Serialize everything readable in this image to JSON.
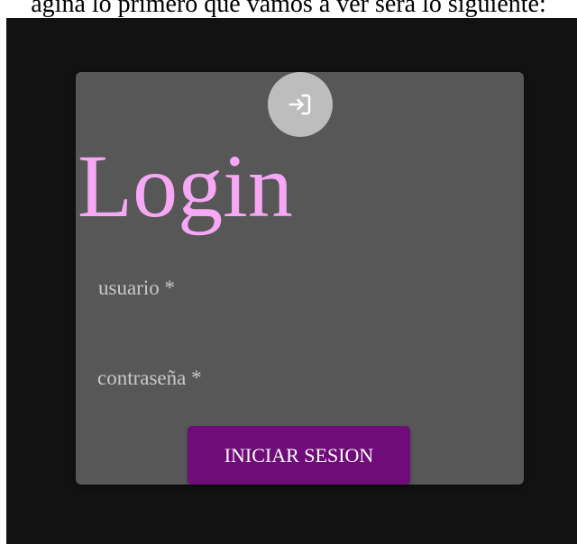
{
  "caption": "ágina lo primero que vamos a ver será lo siguiente:",
  "login": {
    "title": "Login",
    "username_label": "usuario *",
    "password_label": "contraseña *",
    "submit_label": "INICIAR SESION",
    "avatar_icon": "login-icon"
  },
  "colors": {
    "background": "#121212",
    "card": "#575757",
    "title": "#f6a8f5",
    "button": "#700b7a",
    "avatar": "#bdbdbd"
  }
}
